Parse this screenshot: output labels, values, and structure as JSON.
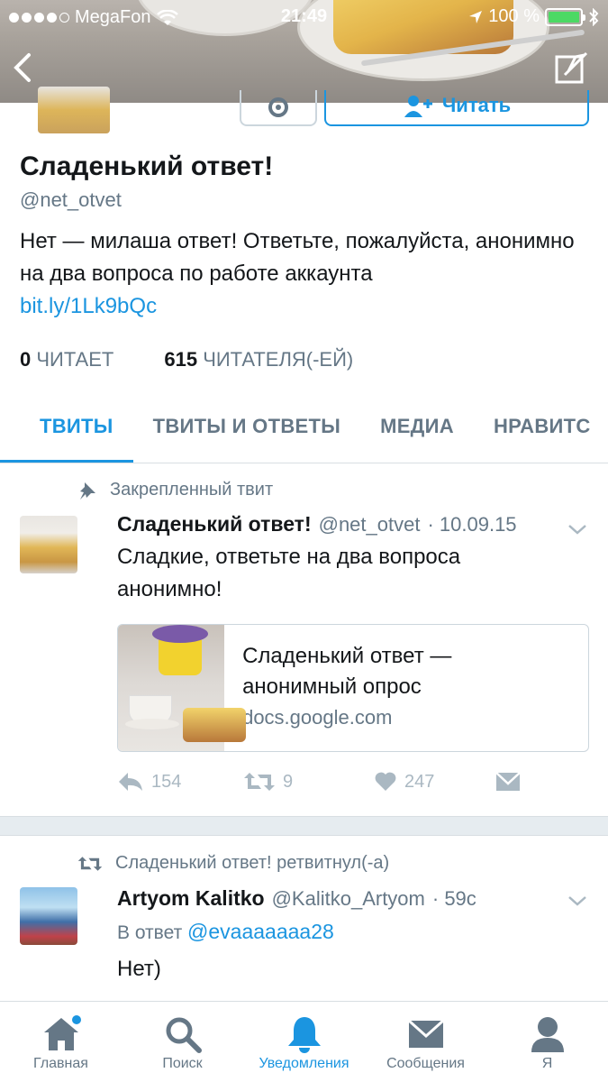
{
  "status_bar": {
    "carrier": "MegaFon",
    "time": "21:49",
    "battery": "100 %"
  },
  "profile": {
    "follow_label": "Читать",
    "name": "Сладенький ответ!",
    "handle": "@net_otvet",
    "bio": "Нет — милаша ответ! Ответьте, пожалуйста, анонимно на два вопроса по работе аккаунта",
    "link": "bit.ly/1Lk9bQc",
    "following_count": "0",
    "following_label": "ЧИТАЕТ",
    "followers_count": "615",
    "followers_label": "ЧИТАТЕЛЯ(-ЕЙ)"
  },
  "tabs": [
    {
      "label": "ТВИТЫ"
    },
    {
      "label": "ТВИТЫ И ОТВЕТЫ"
    },
    {
      "label": "МЕДИА"
    },
    {
      "label": "НРАВИТС"
    }
  ],
  "tweets": [
    {
      "context": "Закрепленный твит",
      "author": "Сладенький ответ!",
      "handle": "@net_otvet",
      "date": "· 10.09.15",
      "text": "Сладкие, ответьте на два вопроса анонимно!",
      "card": {
        "title": "Сладенький ответ — анонимный опрос",
        "domain": "docs.google.com"
      },
      "replies": "154",
      "retweets": "9",
      "likes": "247"
    },
    {
      "context": "Сладенький ответ! ретвитнул(-а)",
      "author": "Artyom Kalitko",
      "handle": "@Kalitko_Artyom",
      "date": "· 59с",
      "reply_prefix": "В ответ",
      "reply_to": "@evaaaaaaa28",
      "text": "Нет)"
    }
  ],
  "nav": [
    {
      "label": "Главная"
    },
    {
      "label": "Поиск"
    },
    {
      "label": "Уведомления"
    },
    {
      "label": "Сообщения"
    },
    {
      "label": "Я"
    }
  ],
  "colors": {
    "accent": "#1b95e0",
    "secondary_text": "#657786",
    "icon_gray": "#aab8c2",
    "battery_green": "#4cd964"
  }
}
